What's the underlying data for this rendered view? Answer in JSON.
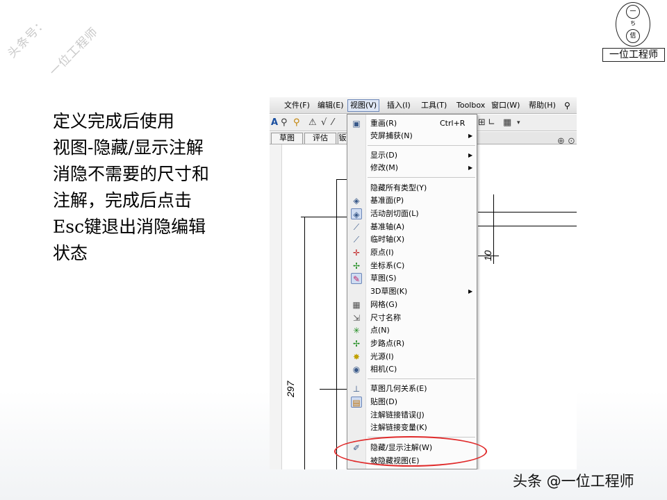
{
  "watermark": {
    "line1": "头条号：",
    "line2": "一位工程师"
  },
  "logo": {
    "label": "一位工程师",
    "glyph_top": "一",
    "glyph_mid": "ち",
    "glyph_bottom": "佶"
  },
  "instruction": {
    "lines": [
      "定义完成后使用",
      "视图-隐藏/显示注解",
      "消隐不需要的尺寸和",
      "注解，完成后点击",
      "Esc键退出消隐编辑",
      "状态"
    ]
  },
  "menubar": {
    "items": [
      "文件(F)",
      "编辑(E)",
      "视图(V)",
      "插入(I)",
      "工具(T)",
      "Toolbox",
      "窗口(W)",
      "帮助(H)"
    ],
    "active": "视图(V)"
  },
  "tabs": [
    "草图",
    "评估",
    "钣"
  ],
  "drawing": {
    "dim_vertical": "297",
    "dim_small": "10"
  },
  "view_menu": {
    "items": [
      {
        "label": "重画(R)",
        "shortcut": "Ctrl+R",
        "icon": "redraw-icon"
      },
      {
        "label": "荧屏捕获(N)",
        "submenu": true
      },
      {
        "label": "显示(D)",
        "submenu": true
      },
      {
        "label": "修改(M)",
        "submenu": true
      },
      {
        "label": "隐藏所有类型(Y)"
      },
      {
        "label": "基准面(P)",
        "icon": "plane-icon"
      },
      {
        "label": "活动剖切面(L)",
        "icon": "section-plane-icon",
        "selected": true
      },
      {
        "label": "基准轴(A)",
        "icon": "axis-icon"
      },
      {
        "label": "临时轴(X)",
        "icon": "temp-axis-icon"
      },
      {
        "label": "原点(I)",
        "icon": "origin-icon"
      },
      {
        "label": "坐标系(C)",
        "icon": "coordinate-system-icon"
      },
      {
        "label": "草图(S)",
        "icon": "sketch-icon",
        "selected": true
      },
      {
        "label": "3D草图(K)",
        "submenu": true
      },
      {
        "label": "网格(G)",
        "icon": "grid-icon"
      },
      {
        "label": "尺寸名称",
        "icon": "dimension-name-icon"
      },
      {
        "label": "点(N)",
        "icon": "point-icon"
      },
      {
        "label": "步路点(R)",
        "icon": "route-point-icon"
      },
      {
        "label": "光源(I)",
        "icon": "light-icon"
      },
      {
        "label": "相机(C)",
        "icon": "camera-icon"
      },
      {
        "label": "草图几何关系(E)",
        "icon": "sketch-relation-icon"
      },
      {
        "label": "贴图(D)",
        "icon": "decal-icon",
        "selected": true
      },
      {
        "label": "注解链接错误(J)"
      },
      {
        "label": "注解链接变量(K)"
      },
      {
        "label": "隐藏/显示注解(W)",
        "icon": "annotation-icon"
      },
      {
        "label": "被隐藏视图(E)"
      }
    ]
  },
  "credit": "头条 @一位工程师",
  "colors": {
    "highlight": "#e02a2a",
    "menu_selection": "#cfdcf2"
  }
}
